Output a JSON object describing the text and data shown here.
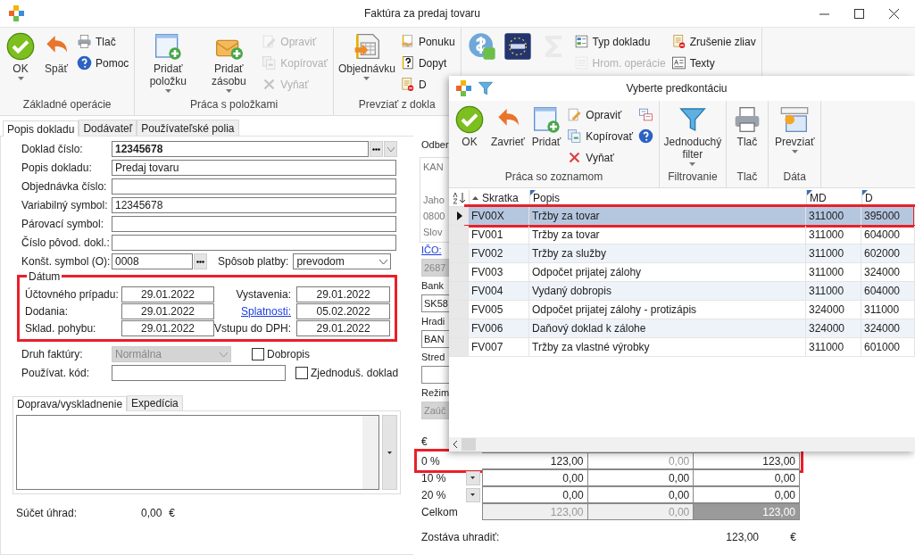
{
  "window": {
    "title": "Faktúra za predaj tovaru"
  },
  "ribbon": {
    "groups": [
      {
        "label": "Základné operácie",
        "items": [
          {
            "kind": "large",
            "label": "OK",
            "dropdown": true,
            "disabled": false
          },
          {
            "kind": "large",
            "label": "Späť",
            "dropdown": false,
            "disabled": false
          },
          {
            "kind": "column",
            "items": [
              {
                "label": "Tlač",
                "disabled": false
              },
              {
                "label": "Pomoc",
                "disabled": false
              }
            ]
          }
        ]
      },
      {
        "label": "Práca s položkami",
        "items": [
          {
            "kind": "large",
            "label": "Pridať položku",
            "dropdown": true,
            "disabled": false
          },
          {
            "kind": "large",
            "label": "Pridať zásobu",
            "dropdown": true,
            "disabled": false
          },
          {
            "kind": "column",
            "items": [
              {
                "label": "Opraviť",
                "disabled": true
              },
              {
                "label": "Kopírovať",
                "disabled": true
              },
              {
                "label": "Vyňať",
                "disabled": true
              }
            ]
          }
        ]
      },
      {
        "label": "Prevziať z dokla",
        "items": [
          {
            "kind": "large",
            "label": "Objednávku",
            "dropdown": true,
            "disabled": false
          },
          {
            "kind": "column",
            "items": [
              {
                "label": "Ponuku",
                "disabled": false
              },
              {
                "label": "Dopyt",
                "disabled": false
              },
              {
                "label": "D",
                "disabled": false
              }
            ]
          }
        ]
      },
      {
        "items": [
          {
            "kind": "large",
            "disabled": false
          },
          {
            "kind": "large",
            "disabled": false
          },
          {
            "kind": "large",
            "disabled": true
          },
          {
            "kind": "column",
            "items": [
              {
                "label": "Typ dokladu",
                "disabled": false
              },
              {
                "label": "Hrom. operácie",
                "disabled": true
              }
            ]
          },
          {
            "kind": "column",
            "items": [
              {
                "label": "Zrušenie zliav",
                "disabled": false
              },
              {
                "label": "Texty",
                "disabled": false
              }
            ]
          }
        ]
      }
    ]
  },
  "form": {
    "tabs": [
      {
        "label": "Popis dokladu",
        "selected": true
      },
      {
        "label": "Dodávateľ",
        "selected": false
      },
      {
        "label": "Používateľské polia",
        "selected": false
      }
    ],
    "fields": [
      {
        "label": "Doklad číslo:",
        "value": "12345678",
        "kind": "lookup"
      },
      {
        "label": "Popis dokladu:",
        "value": "Predaj tovaru",
        "kind": "text"
      },
      {
        "label": "Objednávka číslo:",
        "kind": "text"
      },
      {
        "label": "Variabilný symbol:",
        "value": "12345678",
        "kind": "text"
      },
      {
        "label": "Párovací symbol:",
        "kind": "text"
      },
      {
        "label": "Číslo pôvod. dokl.:",
        "kind": "text"
      }
    ],
    "constant_symbol": {
      "label": "Konšt. symbol (O):",
      "value": "0008"
    },
    "payment": {
      "label": "Spôsob platby:",
      "value": "prevodom"
    },
    "dates": {
      "title": "Dátum",
      "highlighted": true,
      "left": [
        {
          "label": "Účtovného prípadu:",
          "value": "29.01.2022",
          "link": false
        },
        {
          "label": "Dodania:",
          "value": "29.01.2022",
          "link": false
        },
        {
          "label": "Sklad. pohybu:",
          "value": "29.01.2022",
          "link": false
        }
      ],
      "right": [
        {
          "label": "Vystavenia:",
          "value": "29.01.2022",
          "link": false
        },
        {
          "label": "Splatnosti:",
          "value": "05.02.2022",
          "link": true
        },
        {
          "label": "Vstupu do DPH:",
          "value": "29.01.2022",
          "link": false
        }
      ]
    },
    "invoice_type": {
      "label": "Druh faktúry:",
      "value": "Normálna",
      "disabled": true
    },
    "credit_note": {
      "label": "Dobropis",
      "checked": false
    },
    "user_code": {
      "label": "Používat. kód:"
    },
    "simplified": {
      "label": "Zjednoduš. doklad",
      "checked": false
    },
    "subtabs": [
      {
        "label": "Doprava/vyskladnenie",
        "selected": true
      },
      {
        "label": "Expedícia",
        "selected": false
      }
    ],
    "payments_sum": {
      "label": "Súčet úhrad:",
      "value": "0,00",
      "currency": "€"
    }
  },
  "side_column": [
    {
      "kind": "heading",
      "text": "Odber"
    },
    {
      "kind": "box",
      "values": [
        "KAN",
        "Jaho",
        "0800",
        "Slov"
      ]
    },
    {
      "kind": "link",
      "text": "IČO:"
    },
    {
      "kind": "field",
      "value": "2687",
      "disabled": true
    },
    {
      "kind": "label",
      "text": "Bank"
    },
    {
      "kind": "field",
      "value": "SK58",
      "disabled": false
    },
    {
      "kind": "label",
      "text": "Hradi"
    },
    {
      "kind": "field",
      "value": "BAN",
      "disabled": false
    },
    {
      "kind": "label",
      "text": "Stred"
    },
    {
      "kind": "field",
      "disabled": false
    },
    {
      "kind": "label",
      "text": "Režim"
    },
    {
      "kind": "field",
      "value": "Zaúč",
      "disabled": true
    }
  ],
  "vat": {
    "currency": "€",
    "rows": [
      {
        "rate": "0 %",
        "highlighted": true,
        "dropdown": false,
        "cells": [
          {
            "value": "123,00",
            "disabled": false
          },
          {
            "value": "0,00",
            "disabled": true
          },
          {
            "value": "123,00",
            "disabled": false
          }
        ]
      },
      {
        "rate": "10 %",
        "highlighted": false,
        "dropdown": true,
        "cells": [
          {
            "value": "0,00",
            "disabled": false
          },
          {
            "value": "0,00",
            "disabled": false
          },
          {
            "value": "0,00",
            "disabled": false
          }
        ]
      },
      {
        "rate": "20 %",
        "highlighted": false,
        "dropdown": true,
        "cells": [
          {
            "value": "0,00",
            "disabled": false
          },
          {
            "value": "0,00",
            "disabled": false
          },
          {
            "value": "0,00",
            "disabled": false
          }
        ]
      }
    ],
    "total": {
      "label": "Celkom",
      "cells": [
        {
          "value": "123,00",
          "highlighted": false
        },
        {
          "value": "0,00",
          "highlighted": false
        },
        {
          "value": "123,00",
          "highlighted": true
        }
      ]
    },
    "remaining": {
      "label": "Zostáva uhradiť:",
      "value": "123,00",
      "currency": "€"
    }
  },
  "dialog": {
    "title": "Vyberte predkontáciu",
    "ribbon": {
      "groups": [
        {
          "label": "Práca so zoznamom",
          "items": [
            {
              "kind": "large",
              "label": "OK",
              "disabled": false
            },
            {
              "kind": "large",
              "label": "Zavrieť",
              "disabled": false
            },
            {
              "kind": "large",
              "label": "Pridať",
              "disabled": false
            },
            {
              "kind": "column",
              "items": [
                {
                  "label": "Opraviť",
                  "disabled": false
                },
                {
                  "label": "Kopírovať",
                  "disabled": false
                },
                {
                  "label": "Vyňať",
                  "disabled": false
                }
              ]
            },
            {
              "kind": "column",
              "items": [
                {
                  "disabled": false
                },
                {
                  "disabled": false
                }
              ]
            }
          ]
        },
        {
          "label": "Filtrovanie",
          "items": [
            {
              "kind": "large",
              "label": "Jednoduchý filter",
              "dropdown": true,
              "disabled": false
            }
          ]
        },
        {
          "label": "Tlač",
          "items": [
            {
              "kind": "large",
              "label": "Tlač",
              "dropdown": false,
              "disabled": false
            }
          ]
        },
        {
          "label": "Dáta",
          "items": [
            {
              "kind": "large",
              "label": "Prevziať",
              "dropdown": true,
              "disabled": false
            }
          ]
        }
      ]
    },
    "grid": {
      "columns": [
        {
          "label": "Skratka",
          "sorted": true
        },
        {
          "label": "Popis",
          "sorted": false
        },
        {
          "label": "MD",
          "sorted": false
        },
        {
          "label": "D",
          "sorted": false
        }
      ],
      "rows": [
        {
          "cells": [
            "FV00X",
            "Tržby za tovar",
            "311000",
            "395000"
          ],
          "selected": true,
          "highlighted": true
        },
        {
          "cells": [
            "FV001",
            "Tržby za tovar",
            "311000",
            "604000"
          ],
          "selected": false,
          "highlighted": false
        },
        {
          "cells": [
            "FV002",
            "Tržby za služby",
            "311000",
            "602000"
          ],
          "selected": false,
          "highlighted": false
        },
        {
          "cells": [
            "FV003",
            "Odpočet prijatej zálohy",
            "311000",
            "324000"
          ],
          "selected": false,
          "highlighted": false
        },
        {
          "cells": [
            "FV004",
            "Vydaný dobropis",
            "311000",
            "604000"
          ],
          "selected": false,
          "highlighted": false
        },
        {
          "cells": [
            "FV005",
            "Odpočet prijatej zálohy - protizápis",
            "324000",
            "311000"
          ],
          "selected": false,
          "highlighted": false
        },
        {
          "cells": [
            "FV006",
            "Daňový doklad k zálohe",
            "324000",
            "324000"
          ],
          "selected": false,
          "highlighted": false
        },
        {
          "cells": [
            "FV007",
            "Tržby za vlastné výrobky",
            "311000",
            "601000"
          ],
          "selected": false,
          "highlighted": false
        }
      ]
    }
  }
}
